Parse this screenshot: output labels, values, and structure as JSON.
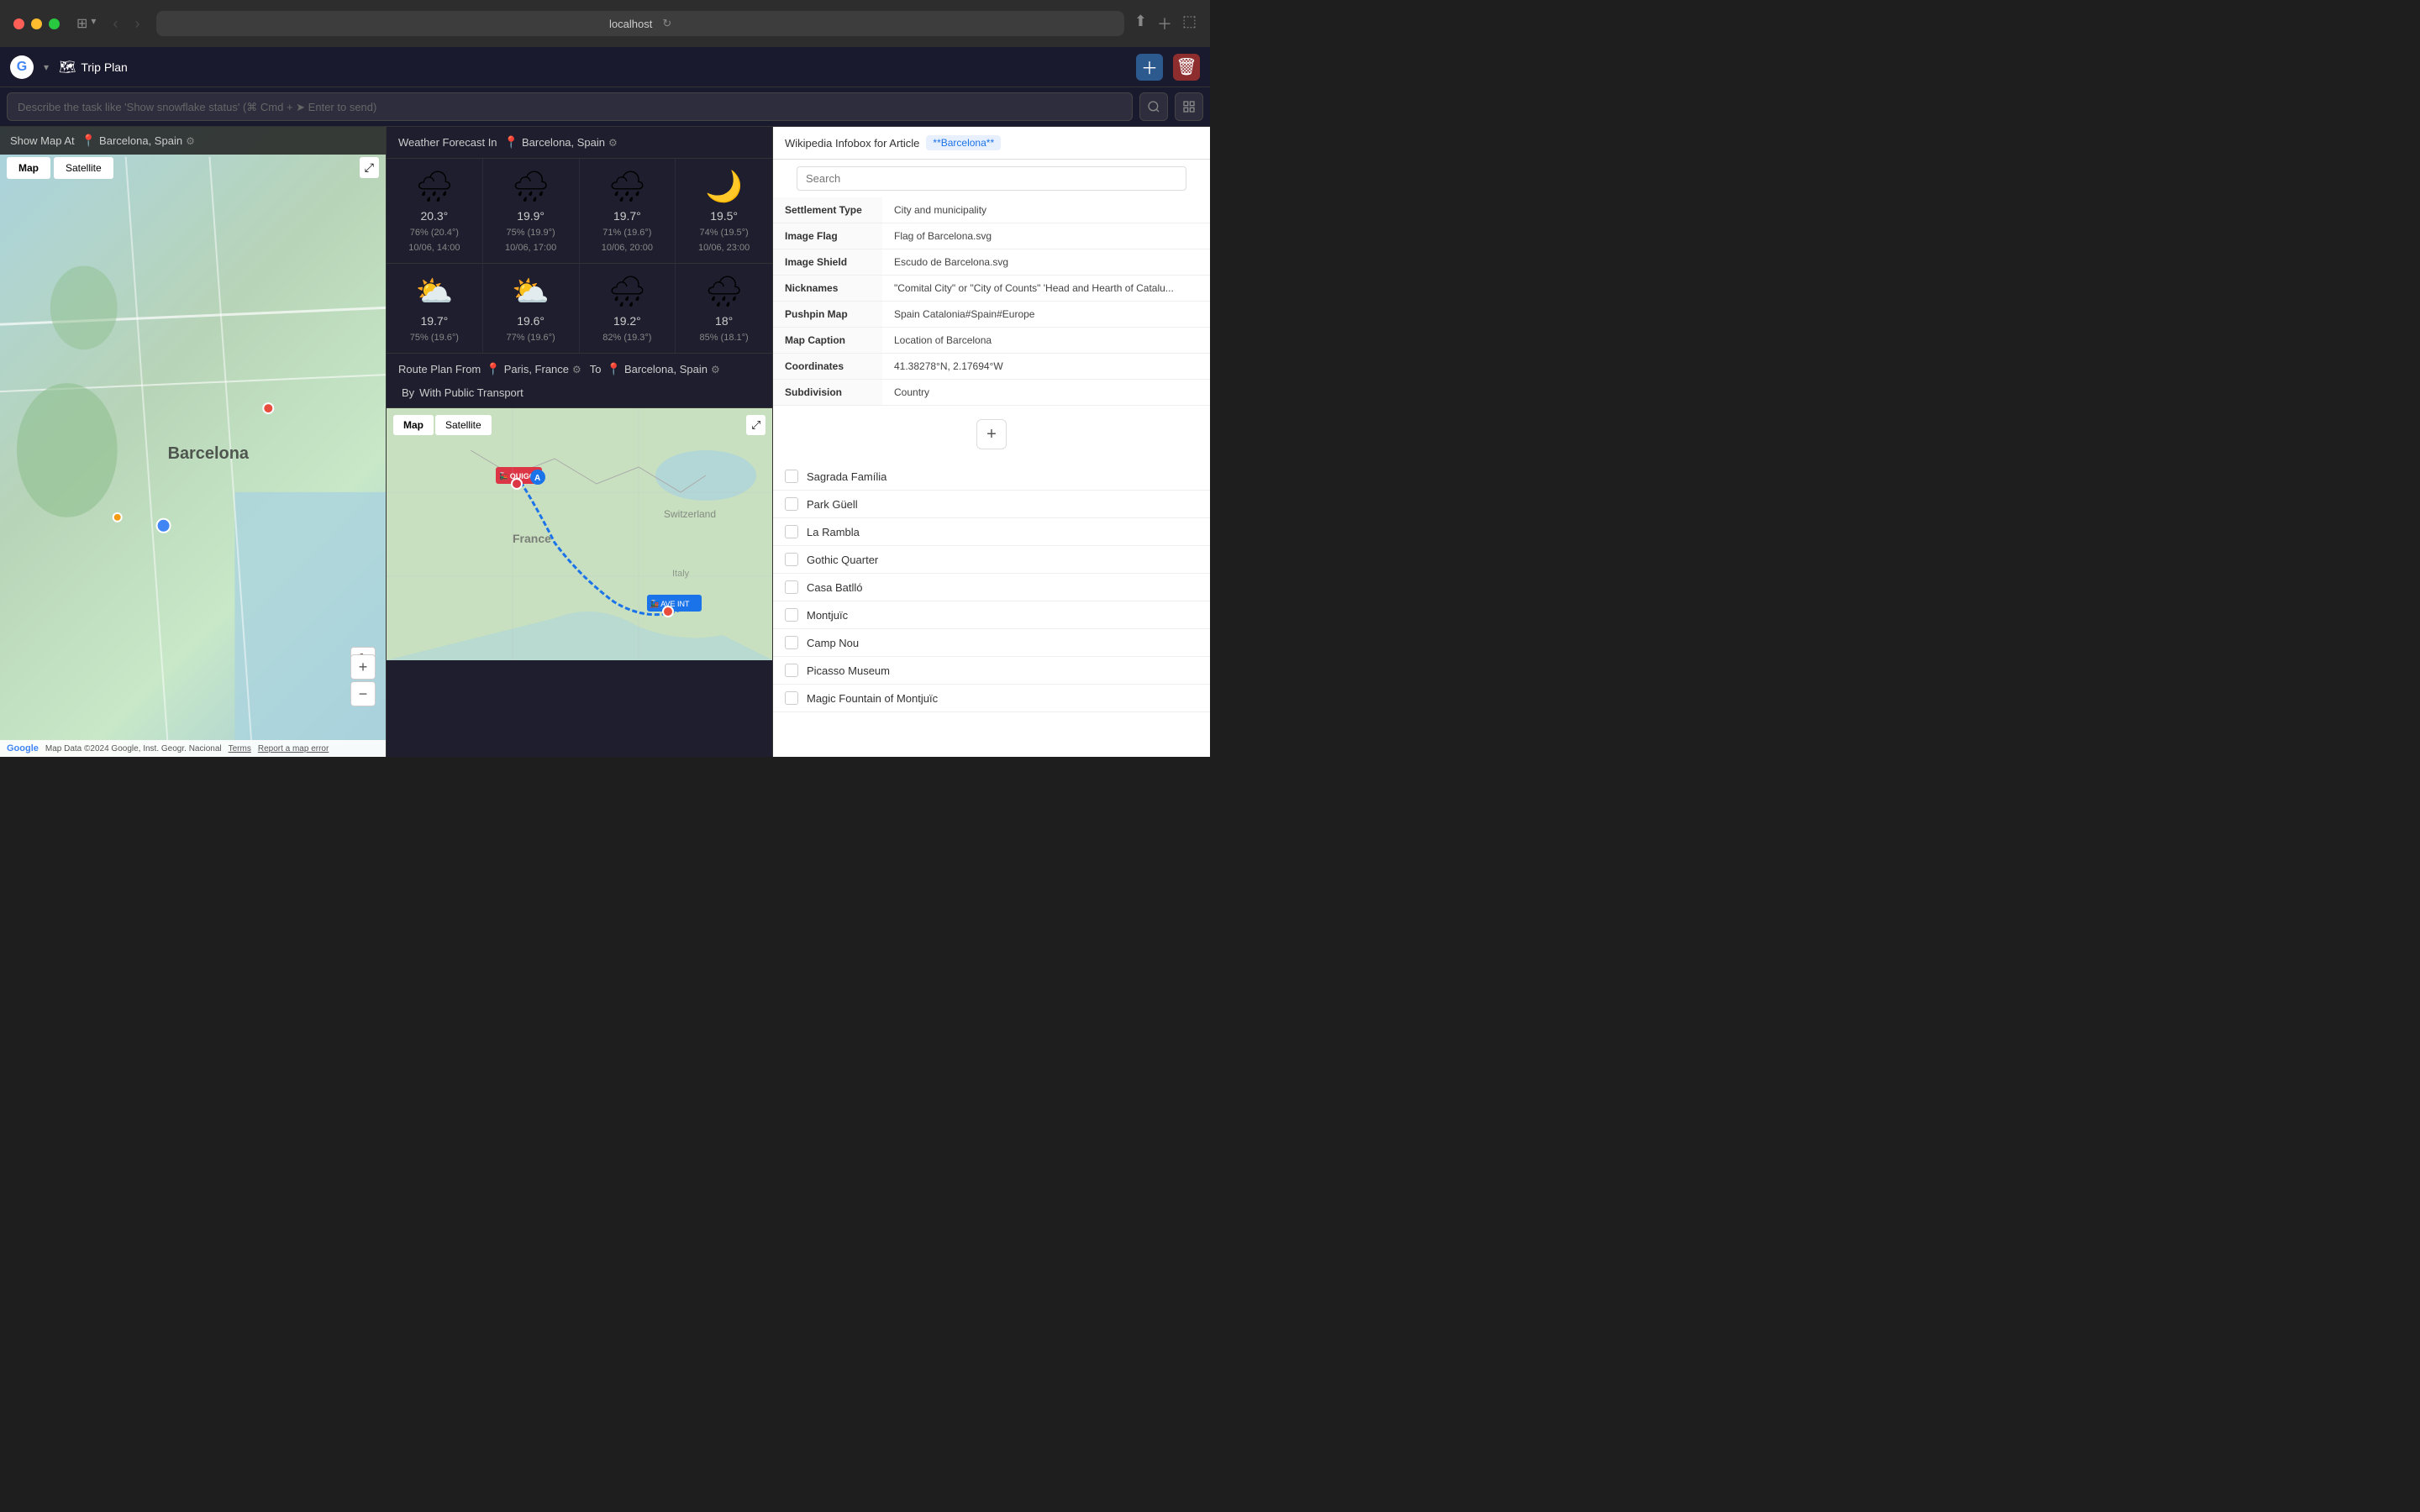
{
  "browser": {
    "address": "localhost",
    "tab_icon": "🗺",
    "tab_title": "Trip Plan"
  },
  "toolbar": {
    "title": "Trip Plan",
    "title_icon": "🗺"
  },
  "command": {
    "placeholder": "Describe the task like 'Show snowflake status' (⌘ Cmd + ➤ Enter to send)"
  },
  "map": {
    "header_label": "Show Map At",
    "location": "Barcelona, Spain",
    "tab_map": "Map",
    "tab_satellite": "Satellite",
    "footer_logo": "Google",
    "footer_copy": "Map Data ©2024 Google, Inst. Geogr. Nacional",
    "footer_terms": "Terms",
    "footer_report": "Report a map error",
    "zoom_in": "+",
    "zoom_out": "−"
  },
  "weather": {
    "header_label": "Weather Forecast In",
    "location": "Barcelona, Spain",
    "forecasts": [
      {
        "icon": "🌧",
        "temp": "20.3°",
        "humidity": "76% (20.4°)",
        "time": "10/06, 14:00"
      },
      {
        "icon": "🌧",
        "temp": "19.9°",
        "humidity": "75% (19.9°)",
        "time": "10/06, 17:00"
      },
      {
        "icon": "🌧",
        "temp": "19.7°",
        "humidity": "71% (19.6°)",
        "time": "10/06, 20:00"
      },
      {
        "icon": "🌙",
        "temp": "19.5°",
        "humidity": "74% (19.5°)",
        "time": "10/06, 23:00"
      },
      {
        "icon": "⛅",
        "temp": "19.7°",
        "humidity": "75% (19.6°)",
        "time": ""
      },
      {
        "icon": "⛅",
        "temp": "19.6°",
        "humidity": "77% (19.6°)",
        "time": ""
      },
      {
        "icon": "🌧",
        "temp": "19.2°",
        "humidity": "82% (19.3°)",
        "time": ""
      },
      {
        "icon": "🌧",
        "temp": "18°",
        "humidity": "85% (18.1°)",
        "time": ""
      }
    ]
  },
  "route": {
    "header_label": "Route Plan From",
    "from": "Paris, France",
    "to_label": "To",
    "to": "Barcelona, Spain",
    "by_label": "By",
    "mode": "With Public Transport",
    "tab_map": "Map",
    "tab_satellite": "Satellite"
  },
  "wikipedia": {
    "header_label": "Wikipedia Infobox for Article",
    "article": "**Barcelona**",
    "search_placeholder": "Search",
    "table": [
      {
        "key": "Settlement Type",
        "value": "City and municipality"
      },
      {
        "key": "Image Flag",
        "value": "Flag of Barcelona.svg"
      },
      {
        "key": "Image Shield",
        "value": "Escudo de Barcelona.svg"
      },
      {
        "key": "Nicknames",
        "value": "\"Comital City\" or \"City of Counts\" 'Head and Hearth of Catalu..."
      },
      {
        "key": "Pushpin Map",
        "value": "Spain Catalonia#Spain#Europe"
      },
      {
        "key": "Map Caption",
        "value": "Location of Barcelona"
      },
      {
        "key": "Coordinates",
        "value": "41.38278°N, 2.17694°W"
      },
      {
        "key": "Subdivision",
        "value": "Country"
      }
    ],
    "add_button": "+",
    "attractions": [
      "Sagrada Família",
      "Park Güell",
      "La Rambla",
      "Gothic Quarter",
      "Casa Batlló",
      "Montjuïc",
      "Camp Nou",
      "Picasso Museum",
      "Magic Fountain of Montjuïc"
    ]
  }
}
